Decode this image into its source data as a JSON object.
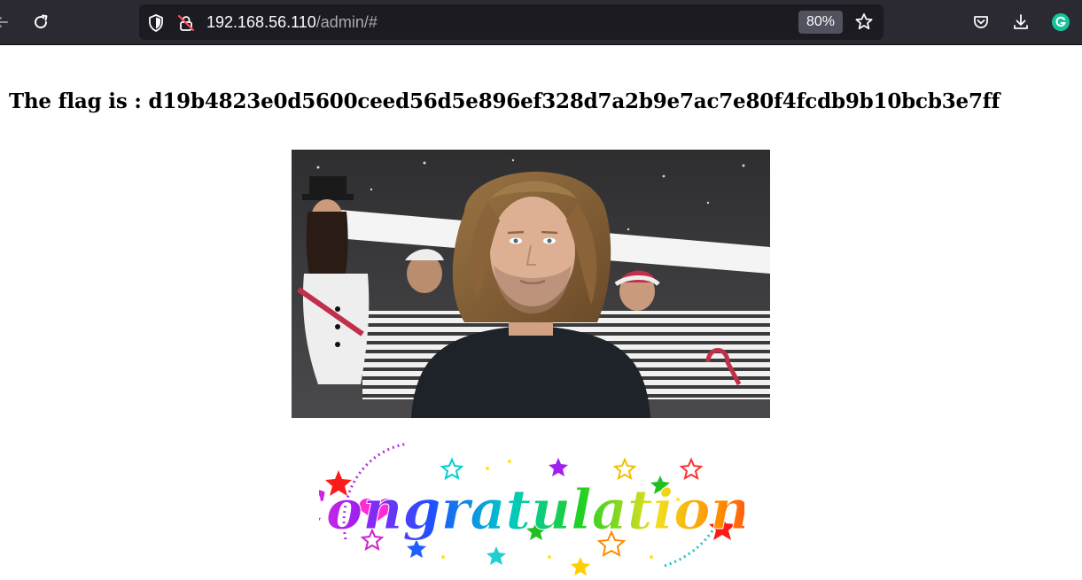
{
  "browser": {
    "url_host": "192.168.56.110",
    "url_path": "/admin/#",
    "zoom": "80%"
  },
  "icons": {
    "back": "back-arrow-icon",
    "reload": "reload-icon",
    "shield": "tracking-protection-shield-icon",
    "lock": "insecure-lock-icon",
    "bookmark": "bookmark-star-icon",
    "pocket": "pocket-icon",
    "downloads": "download-icon",
    "grammarly": "grammarly-icon"
  },
  "page": {
    "heading": "The flag is : d19b4823e0d5600ceed56d5e896ef328d7a2b9e7ac7e80f4fcdb9b10bcb3e7ff",
    "congrats_text": "Congratulations"
  },
  "colors": {
    "toolbar_bg": "#2b2a33",
    "urlbar_bg": "#1c1b22",
    "grammarly_green": "#15c39a"
  }
}
